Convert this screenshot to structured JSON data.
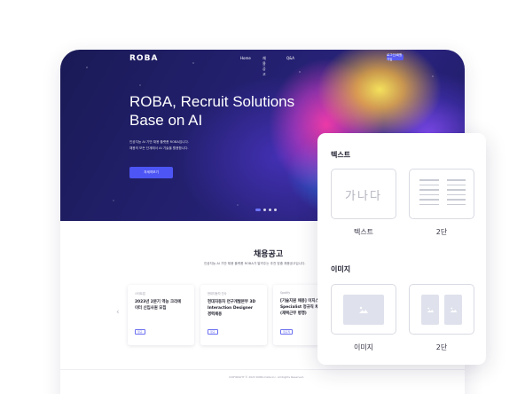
{
  "site": {
    "logo": "ROBA",
    "nav": [
      "Home",
      "채용공고",
      "Q&A"
    ],
    "nav_button": "로그인/회원가입",
    "hero_title_line1": "ROBA, Recruit Solutions",
    "hero_title_line2": "Base on AI",
    "hero_sub_line1": "인공지능 AI 기반 채용 플랫폼 ROBA입니다.",
    "hero_sub_line2": "채용의 모든 단계에서 AI 기술을 활용합니다.",
    "cta": "자세히보기",
    "slide_count": 4,
    "active_slide": 1
  },
  "jobs": {
    "title": "채용공고",
    "subtitle": "인공지능 AI 기반 채용 플랫폼 ROBA가 알려주는 추천 맞춤 채용공고입니다.",
    "cards": [
      {
        "category": "스타트업",
        "title_line1": "2023년 2분기 역능 크리에",
        "title_line2": "이터 신입사원 모집",
        "tag": "정규"
      },
      {
        "category": "현대자동차 인사",
        "title_line1": "현대자동차 연구개발본부 3D",
        "title_line2": "Interaction Designer",
        "title_line3": "경력채용",
        "tag": "정규"
      },
      {
        "category": "Spotify",
        "title_line1": "[기술지원 채용] 이지스C",
        "title_line2": "Specialist 정규직 채용",
        "title_line3": "(재택근무 병행)",
        "tag": "정규직"
      }
    ]
  },
  "footer": {
    "copyright": "COPYRIGHT © 2023 ROBA Data Inc. All Rights Reserved."
  },
  "panel": {
    "text_section": "텍스트",
    "text_sample": "가나다",
    "text_label": "텍스트",
    "text_two_col_label": "2단",
    "image_section": "이미지",
    "image_label": "이미지",
    "image_two_col_label": "2단"
  },
  "colors": {
    "accent": "#4d55f5",
    "hero_bg": "#1f1d66"
  }
}
